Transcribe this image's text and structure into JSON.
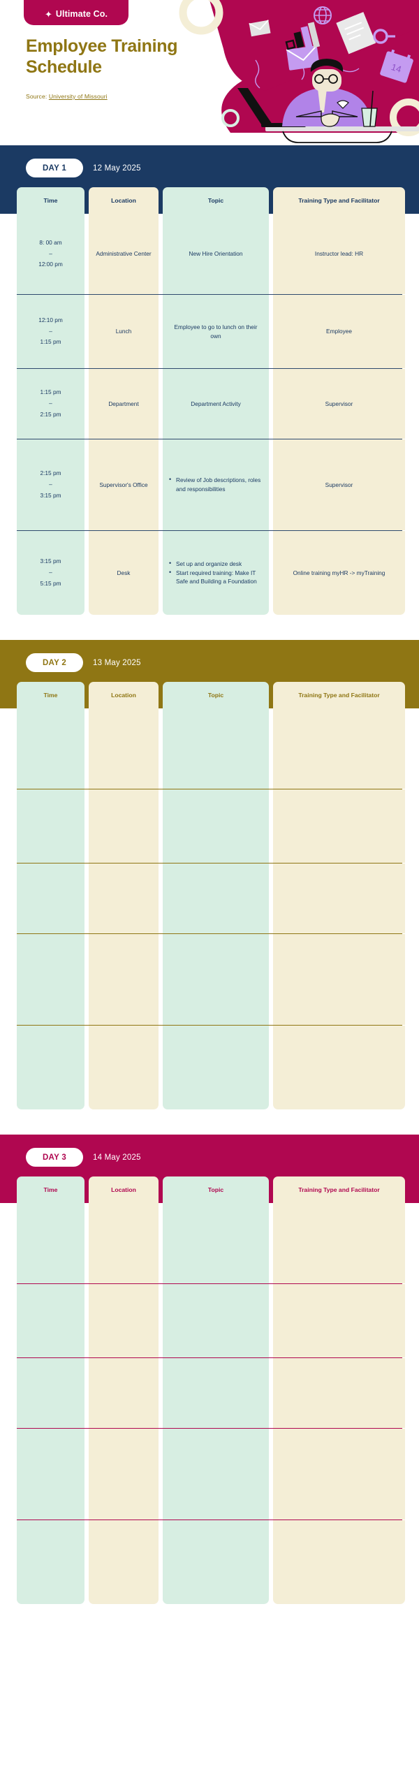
{
  "brand": {
    "logo_text": "Ultimate Co.",
    "logo_icon": "sparkle-icon",
    "colors": {
      "crimson": "#b00750",
      "navy": "#1b3a63",
      "olive": "#8f7614",
      "mint": "#d7eee2",
      "cream": "#f4eed6"
    }
  },
  "hero": {
    "title": "Employee Training Schedule",
    "source_label": "Source:",
    "source_link": "University of Missouri"
  },
  "columns": [
    "Time",
    "Location",
    "Topic",
    "Training Type and Facilitator"
  ],
  "days": [
    {
      "badge": "DAY 1",
      "date": "12 May 2025",
      "theme": "navy",
      "rows": [
        {
          "time": "8: 00 am\n–\n12:00 pm",
          "location": "Administrative Center",
          "topic": "New Hire Orientation",
          "topic_bullets": [],
          "facilitator": "Instructor lead: HR"
        },
        {
          "time": "12:10 pm\n–\n1:15 pm",
          "location": "Lunch",
          "topic": "Employee to go to lunch on their own",
          "topic_bullets": [],
          "facilitator": "Employee"
        },
        {
          "time": "1:15 pm\n–\n2:15 pm",
          "location": "Department",
          "topic": "Department Activity",
          "topic_bullets": [],
          "facilitator": "Supervisor"
        },
        {
          "time": "2:15 pm\n–\n3:15 pm",
          "location": "Supervisor's Office",
          "topic": "",
          "topic_bullets": [
            "Review of Job descriptions, roles and responsibilities"
          ],
          "facilitator": "Supervisor"
        },
        {
          "time": "3:15 pm\n–\n5:15 pm",
          "location": "Desk",
          "topic": "",
          "topic_bullets": [
            "Set up and organize desk",
            "Start required training: Make IT Safe and Building a Foundation"
          ],
          "facilitator": "Online training myHR -> myTraining"
        }
      ]
    },
    {
      "badge": "DAY 2",
      "date": "13 May 2025",
      "theme": "olive",
      "rows": [
        {
          "time": "",
          "location": "",
          "topic": "",
          "topic_bullets": [],
          "facilitator": ""
        },
        {
          "time": "",
          "location": "",
          "topic": "",
          "topic_bullets": [],
          "facilitator": ""
        },
        {
          "time": "",
          "location": "",
          "topic": "",
          "topic_bullets": [],
          "facilitator": ""
        },
        {
          "time": "",
          "location": "",
          "topic": "",
          "topic_bullets": [],
          "facilitator": ""
        },
        {
          "time": "",
          "location": "",
          "topic": "",
          "topic_bullets": [],
          "facilitator": ""
        }
      ]
    },
    {
      "badge": "DAY 3",
      "date": "14 May 2025",
      "theme": "crimson",
      "rows": [
        {
          "time": "",
          "location": "",
          "topic": "",
          "topic_bullets": [],
          "facilitator": ""
        },
        {
          "time": "",
          "location": "",
          "topic": "",
          "topic_bullets": [],
          "facilitator": ""
        },
        {
          "time": "",
          "location": "",
          "topic": "",
          "topic_bullets": [],
          "facilitator": ""
        },
        {
          "time": "",
          "location": "",
          "topic": "",
          "topic_bullets": [],
          "facilitator": ""
        },
        {
          "time": "",
          "location": "",
          "topic": "",
          "topic_bullets": [],
          "facilitator": ""
        }
      ]
    }
  ]
}
